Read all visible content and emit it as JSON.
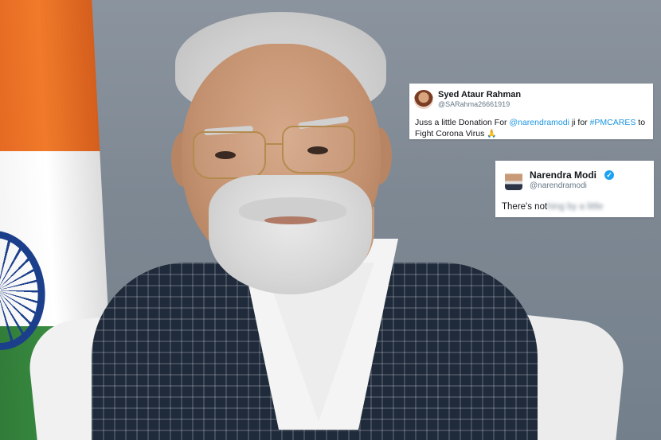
{
  "tweets": [
    {
      "name": "Syed Ataur Rahman",
      "handle": "@SARahma26661919",
      "text_prefix": "Juss a little Donation For ",
      "mention": "@narendramodi",
      "text_middle": " ji for  ",
      "hashtag": "#PMCARES",
      "text_suffix": " to",
      "text_line2": "Fight Corona Virus",
      "emoji": "🙏"
    },
    {
      "name": "Narendra Modi",
      "handle": "@narendramodi",
      "verified": true,
      "text_visible": "There's not",
      "text_blurred": "hing by a little"
    }
  ],
  "colors": {
    "link": "#1b95e0",
    "verified_badge": "#1da1f2",
    "handle_gray": "#657786"
  }
}
